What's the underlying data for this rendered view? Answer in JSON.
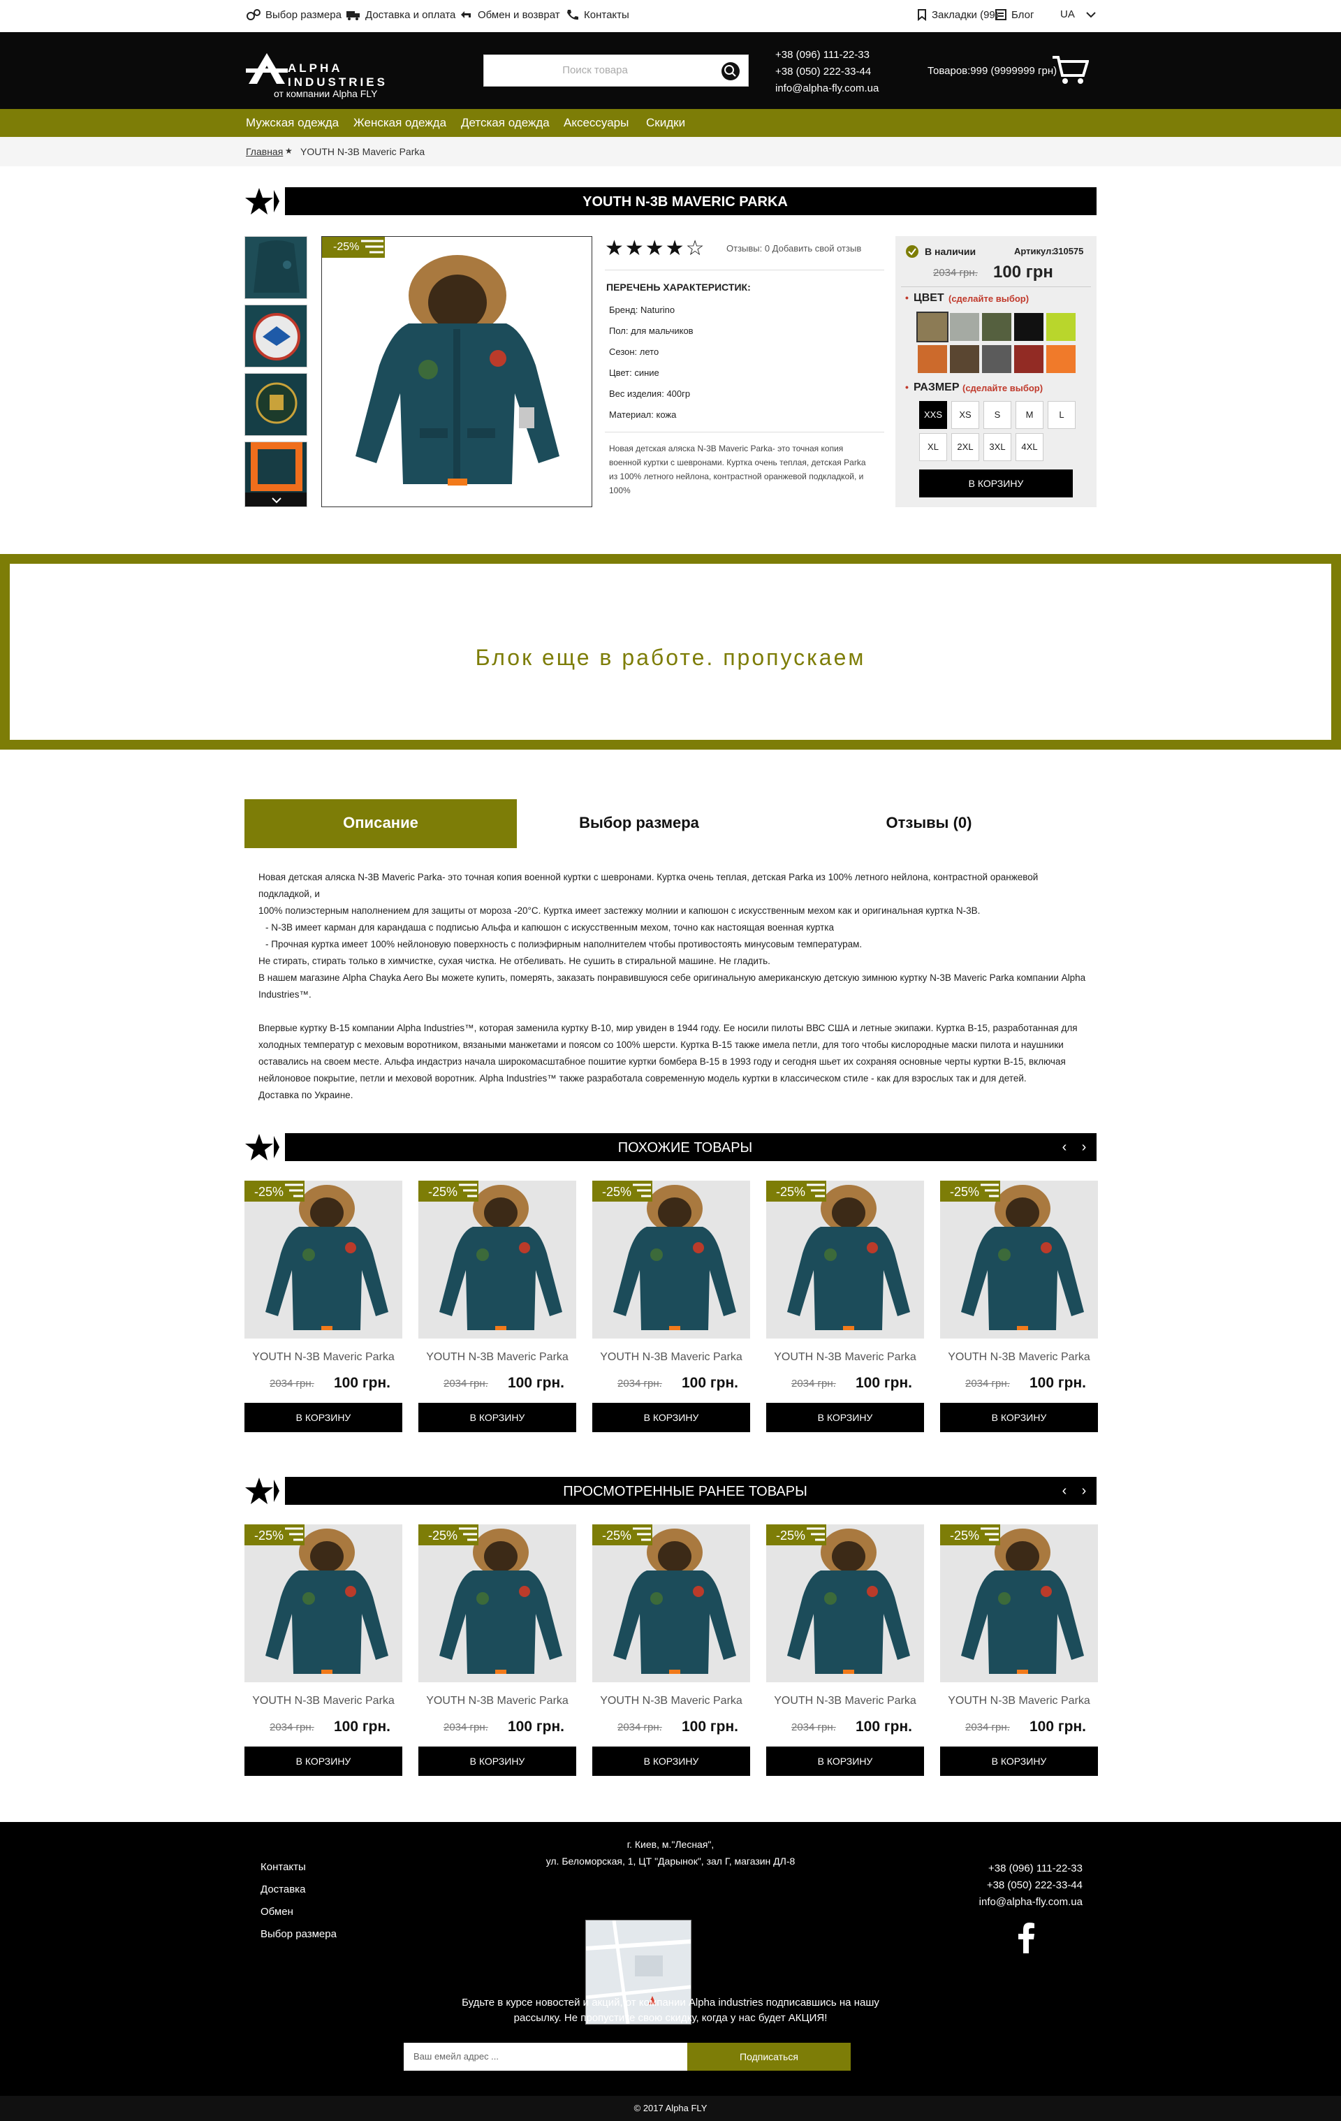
{
  "topbar": {
    "size_guide": "Выбор размера",
    "delivery": "Доставка и оплата",
    "exchange": "Обмен и возврат",
    "contacts": "Контакты",
    "bookmarks": "Закладки (99)",
    "blog": "Блог",
    "lang": "UA"
  },
  "header": {
    "logo_brand": "ALPHA INDUSTRIES",
    "logo_sub": "от компании Alpha FLY",
    "search_placeholder": "Поиск товара",
    "phone1": "+38 (096) 111-22-33",
    "phone2": "+38 (050) 222-33-44",
    "email": "info@alpha-fly.com.ua",
    "cart_summary": "Товаров:999 (9999999 грн)"
  },
  "nav": [
    "Мужская одежда",
    "Женская одежда",
    "Детская одежда",
    "Аксессуары",
    "Скидки"
  ],
  "breadcrumbs": {
    "home": "Главная",
    "current": "YOUTH N-3B Maveric Parka"
  },
  "product": {
    "title": "YOUTH N-3B MAVERIC PARKA",
    "discount": "-25%",
    "stars": "★★★★☆",
    "rating": 4,
    "reviews_link": "Отзывы: 0  Добавить свой отзыв",
    "specs_title": "ПЕРЕЧЕНЬ ХАРАКТЕРИСТИК:",
    "specs": [
      "Бренд: Naturino",
      "Пол: для мальчиков",
      "Сезон: лето",
      "Цвет: синие",
      "Вес изделия: 400гр",
      "Материал: кожа"
    ],
    "short_desc": "Новая детская аляска N-3B Maveric Parka- это точная копия военной куртки с шевронами. Куртка очень теплая, детская Parka из 100% летного нейлона, контрастной оранжевой подкладкой, и 100%",
    "availability": "В наличии",
    "sku_label": "Артикул:",
    "sku": "310575",
    "old_price": "2034 грн.",
    "price": "100 грн",
    "color_label": "ЦВЕТ",
    "color_hint": "(сделайте выбор)",
    "colors": [
      "#8c7b55",
      "#a5aaa3",
      "#55603f",
      "#111111",
      "#b9d62c",
      "#cc6a2c",
      "#5a4631",
      "#5b5b5b",
      "#922b24",
      "#f07a2a"
    ],
    "size_label": "РАЗМЕР",
    "size_hint": "(сделайте выбор)",
    "sizes": [
      "XXS",
      "XS",
      "S",
      "M",
      "L",
      "XL",
      "2XL",
      "3XL",
      "4XL"
    ],
    "selected_size": "XXS",
    "add_to_cart": "В КОРЗИНУ"
  },
  "wip_text": "Блок еще в работе. пропускаем",
  "tabs": [
    "Описание",
    "Выбор размера",
    "Отзывы (0)"
  ],
  "description": [
    "Новая детская аляска N-3B Maveric Parka- это точная копия военной куртки с шевронами. Куртка очень теплая, детская Parka из 100% летного нейлона, контрастной оранжевой подкладкой, и",
    "100% полиэстерным наполнением для защиты от мороза -20°С. Куртка имеет застежку молнии и капюшон с искусственным мехом как и оригинальная куртка N-3B.",
    "-   N-3B имеет карман для карандаша с подписью Альфа и капюшон с искусственным мехом, точно как настоящая военная куртка",
    "-   Прочная куртка имеет 100% нейлоновую поверхность с полиэфирным наполнителем чтобы противостоять минусовым температурам.",
    "Не стирать, стирать только в химчистке, сухая чистка. Не отбеливать. Не сушить в стиральной машине. Не гладить.",
    "В нашем магазине Alpha Chayka Aero Вы можете купить, померять, заказать понравившуюся себе оригинальную американскую детскую зимнюю куртку N-3B Maveric Parka компании Alpha",
    "Industries™.",
    "",
    "Впервые куртку B-15 компании Alpha Industries™, которая заменила куртку B-10, мир увиден в 1944 году. Ее носили пилоты ВВС США и летные экипажи. Куртка B-15, разработанная для",
    "холодных температур с меховым воротником, вязаными манжетами и поясом со 100% шерсти. Куртка B-15 также имела петли, для того чтобы кислородные маски пилота и наушники",
    "оставались на своем месте. Альфа индастриз начала широкомасштабное пошитие куртки бомбера B-15 в 1993 году и сегодня шьет их сохраняя основные черты куртки B-15, включая",
    "нейлоновое покрытие, петли и меховой воротник. Alpha Industries™ также разработала современную модель куртки в классическом стиле - как для взрослых так и для детей.",
    "Доставка по Украине."
  ],
  "similar": {
    "title": "ПОХОЖИЕ ТОВАРЫ",
    "items": [
      {
        "discount": "-25%",
        "name": "YOUTH N-3B Maveric Parka",
        "old_price": "2034 грн.",
        "price": "100 грн.",
        "button": "В КОРЗИНУ"
      },
      {
        "discount": "-25%",
        "name": "YOUTH N-3B Maveric Parka",
        "old_price": "2034 грн.",
        "price": "100 грн.",
        "button": "В КОРЗИНУ"
      },
      {
        "discount": "-25%",
        "name": "YOUTH N-3B Maveric Parka",
        "old_price": "2034 грн.",
        "price": "100 грн.",
        "button": "В КОРЗИНУ"
      },
      {
        "discount": "-25%",
        "name": "YOUTH N-3B Maveric Parka",
        "old_price": "2034 грн.",
        "price": "100 грн.",
        "button": "В КОРЗИНУ"
      },
      {
        "discount": "-25%",
        "name": "YOUTH N-3B Maveric Parka",
        "old_price": "2034 грн.",
        "price": "100 грн.",
        "button": "В КОРЗИНУ"
      }
    ]
  },
  "viewed": {
    "title": "ПРОСМОТРЕННЫЕ РАНЕЕ ТОВАРЫ",
    "items": [
      {
        "discount": "-25%",
        "name": "YOUTH N-3B Maveric Parka",
        "old_price": "2034 грн.",
        "price": "100 грн.",
        "button": "В КОРЗИНУ"
      },
      {
        "discount": "-25%",
        "name": "YOUTH N-3B Maveric Parka",
        "old_price": "2034 грн.",
        "price": "100 грн.",
        "button": "В КОРЗИНУ"
      },
      {
        "discount": "-25%",
        "name": "YOUTH N-3B Maveric Parka",
        "old_price": "2034 грн.",
        "price": "100 грн.",
        "button": "В КОРЗИНУ"
      },
      {
        "discount": "-25%",
        "name": "YOUTH N-3B Maveric Parka",
        "old_price": "2034 грн.",
        "price": "100 грн.",
        "button": "В КОРЗИНУ"
      },
      {
        "discount": "-25%",
        "name": "YOUTH N-3B Maveric Parka",
        "old_price": "2034 грн.",
        "price": "100 грн.",
        "button": "В КОРЗИНУ"
      }
    ]
  },
  "footer": {
    "links": [
      "Контакты",
      "Доставка",
      "Обмен",
      "Выбор размера"
    ],
    "address1": "г. Киев, м.\"Лесная\",",
    "address2": "ул. Беломорская, 1, ЦТ \"Дарынок\", зал Г, магазин ДЛ-8",
    "phone1": "+38 (096) 111-22-33",
    "phone2": "+38 (050) 222-33-44",
    "email": "info@alpha-fly.com.ua",
    "subscribe_text": "Будьте в курсе новостей и акций, от компании Alpha industries подписавшись на нашу рассылку. Не пропустите свою скидку, когда у нас будет АКЦИЯ!",
    "email_placeholder": "Ваш емейл адрес ...",
    "subscribe_button": "Подписаться",
    "copyright": "© 2017 Alpha FLY"
  },
  "colors": {
    "accent": "#7d7d07",
    "header_bg": "#0a0a0a"
  }
}
